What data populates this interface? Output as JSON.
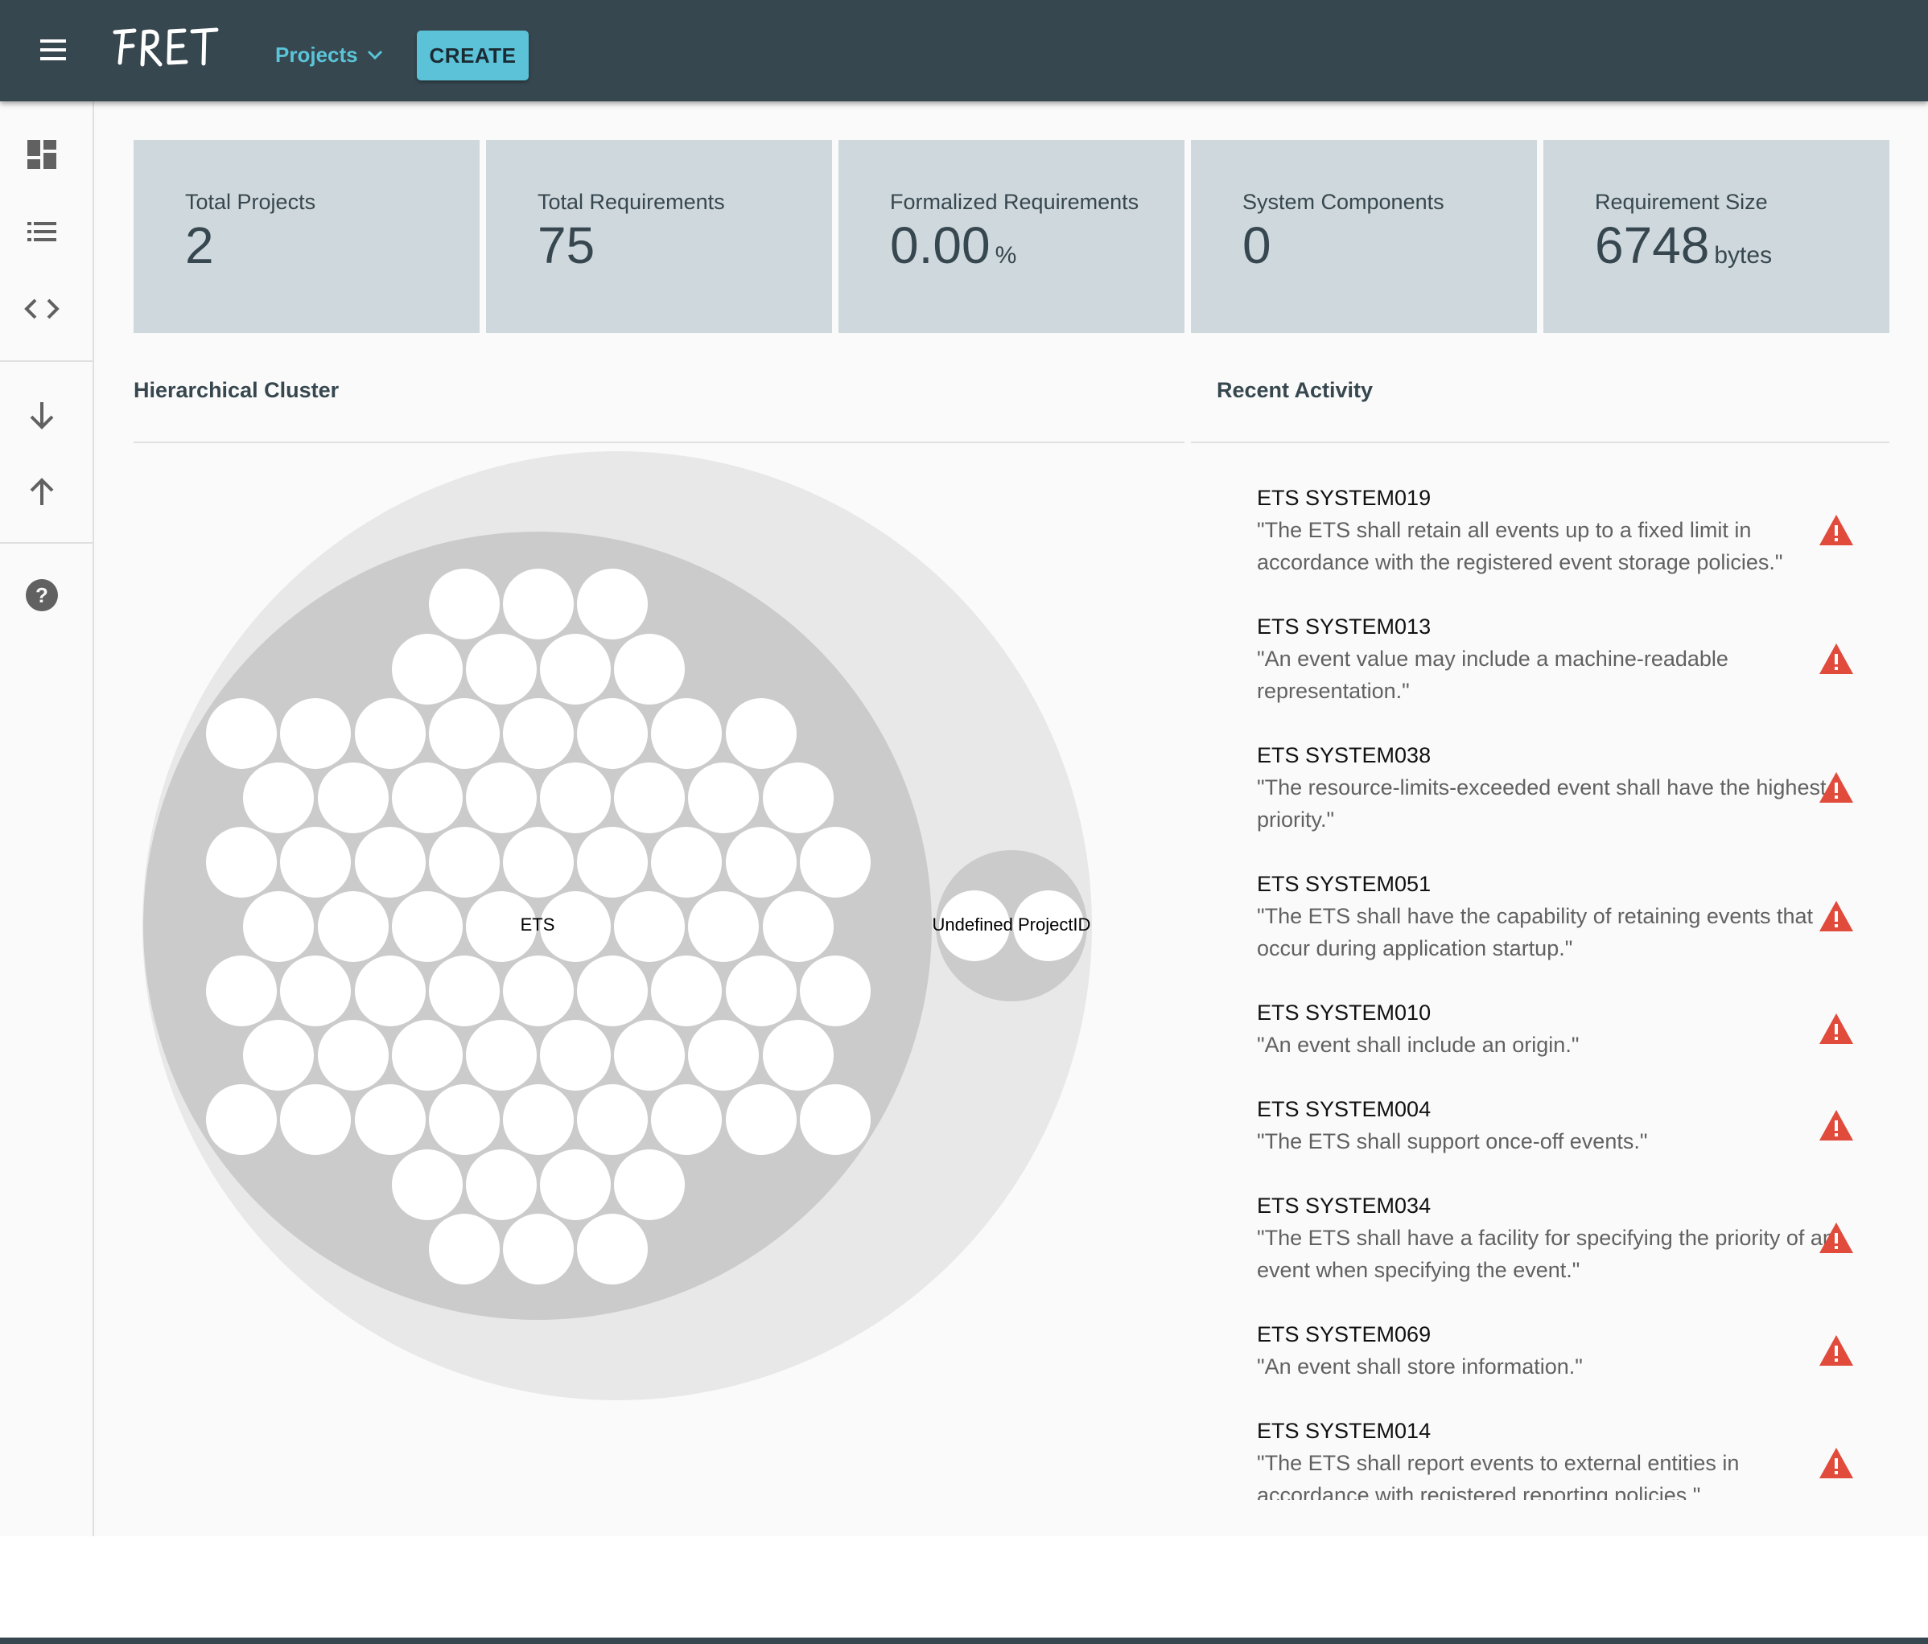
{
  "header": {
    "menu_icon": "menu-icon",
    "logo_text": "FRET",
    "projects_label": "Projects",
    "create_label": "CREATE",
    "colors": {
      "bar": "#37474f",
      "accent": "#5ac4d9"
    }
  },
  "sidebar": {
    "items": [
      {
        "name": "dashboard-icon"
      },
      {
        "name": "list-icon"
      },
      {
        "name": "code-icon"
      },
      {
        "name": "download-icon"
      },
      {
        "name": "upload-icon"
      },
      {
        "name": "help-icon"
      }
    ]
  },
  "stats": [
    {
      "label": "Total Projects",
      "value": "2",
      "unit": ""
    },
    {
      "label": "Total Requirements",
      "value": "75",
      "unit": ""
    },
    {
      "label": "Formalized Requirements",
      "value": "0.00",
      "unit": "%"
    },
    {
      "label": "System Components",
      "value": "0",
      "unit": ""
    },
    {
      "label": "Requirement Size",
      "value": "6748",
      "unit": "bytes"
    }
  ],
  "cluster": {
    "title": "Hierarchical Cluster",
    "groups": [
      {
        "label": "ETS",
        "count": 73
      },
      {
        "label": "Undefined ProjectID",
        "count": 2
      }
    ]
  },
  "activity": {
    "title": "Recent Activity",
    "status_icon": "warning-icon",
    "items": [
      {
        "id": "ETS SYSTEM019",
        "text": "\"The ETS shall retain all events up to a fixed limit in accordance with the registered event storage policies.\""
      },
      {
        "id": "ETS SYSTEM013",
        "text": "\"An event value may include a machine-readable representation.\""
      },
      {
        "id": "ETS SYSTEM038",
        "text": "\"The resource-limits-exceeded event shall have the highest priority.\""
      },
      {
        "id": "ETS SYSTEM051",
        "text": "\"The ETS shall have the capability of retaining events that occur during application startup.\""
      },
      {
        "id": "ETS SYSTEM010",
        "text": "\"An event shall include an origin.\""
      },
      {
        "id": "ETS SYSTEM004",
        "text": "\"The ETS shall support once-off events.\""
      },
      {
        "id": "ETS SYSTEM034",
        "text": "\"The ETS shall have a facility for specifying the priority of an event when specifying the event.\""
      },
      {
        "id": "ETS SYSTEM069",
        "text": "\"An event shall store information.\""
      },
      {
        "id": "ETS SYSTEM014",
        "text": "\"The ETS shall report events to external entities in accordance with registered reporting policies.\""
      }
    ]
  }
}
